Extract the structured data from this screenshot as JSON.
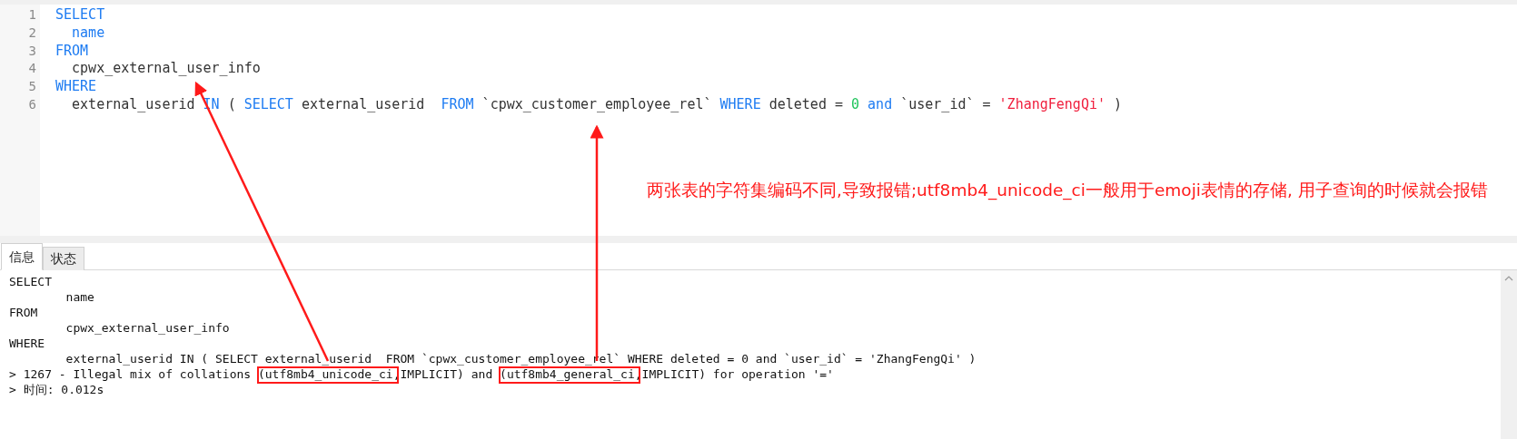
{
  "editor": {
    "lines": [
      {
        "number": "1",
        "tokens": [
          {
            "text": "SELECT",
            "kind": "keyword"
          }
        ]
      },
      {
        "number": "2",
        "tokens": [
          {
            "text": "  name",
            "kind": "keyword"
          }
        ]
      },
      {
        "number": "3",
        "tokens": [
          {
            "text": "FROM",
            "kind": "keyword"
          }
        ]
      },
      {
        "number": "4",
        "tokens": [
          {
            "text": "  cpwx_external_user_info",
            "kind": "plain"
          }
        ]
      },
      {
        "number": "5",
        "tokens": [
          {
            "text": "WHERE",
            "kind": "keyword"
          }
        ]
      },
      {
        "number": "6",
        "tokens": [
          {
            "text": "  external_userid ",
            "kind": "plain"
          },
          {
            "text": "IN",
            "kind": "keyword"
          },
          {
            "text": " ( ",
            "kind": "plain"
          },
          {
            "text": "SELECT",
            "kind": "keyword"
          },
          {
            "text": " external_userid  ",
            "kind": "plain"
          },
          {
            "text": "FROM",
            "kind": "keyword"
          },
          {
            "text": " `cpwx_customer_employee_rel` ",
            "kind": "plain"
          },
          {
            "text": "WHERE",
            "kind": "keyword"
          },
          {
            "text": " deleted = ",
            "kind": "plain"
          },
          {
            "text": "0",
            "kind": "number"
          },
          {
            "text": " and",
            "kind": "keyword"
          },
          {
            "text": " `user_id` = ",
            "kind": "plain"
          },
          {
            "text": "'ZhangFengQi'",
            "kind": "string"
          },
          {
            "text": " )",
            "kind": "plain"
          }
        ]
      }
    ],
    "note": "两张表的字符集编码不同,导致报错;utf8mb4_unicode_ci一般用于emoji表情的存储, 用子查询的时候就会报错"
  },
  "tabs": [
    {
      "label": "信息",
      "selected": true
    },
    {
      "label": "状态",
      "selected": false
    }
  ],
  "output": {
    "lines": [
      {
        "tokens": [
          {
            "text": "SELECT",
            "kind": "plain"
          }
        ]
      },
      {
        "tokens": [
          {
            "text": "        name",
            "kind": "plain"
          }
        ]
      },
      {
        "tokens": [
          {
            "text": "FROM",
            "kind": "plain"
          }
        ]
      },
      {
        "tokens": [
          {
            "text": "        cpwx_external_user_info",
            "kind": "plain"
          }
        ]
      },
      {
        "tokens": [
          {
            "text": "WHERE",
            "kind": "plain"
          }
        ]
      },
      {
        "tokens": [
          {
            "text": "        external_userid IN ( SELECT external_userid  FROM `cpwx_customer_employee_rel` WHERE deleted = 0 and `user_id` = 'ZhangFengQi' )",
            "kind": "plain"
          }
        ]
      },
      {
        "tokens": [
          {
            "text": "> 1267 - Illegal mix of collations (",
            "kind": "plain"
          },
          {
            "text": "utf8mb4_unicode_ci",
            "kind": "boxed"
          },
          {
            "text": ",IMPLICIT) and (",
            "kind": "plain"
          },
          {
            "text": "utf8mb4_general_ci",
            "kind": "boxed"
          },
          {
            "text": ",IMPLICIT) for operation '='",
            "kind": "plain"
          }
        ]
      },
      {
        "tokens": [
          {
            "text": "> 时间: 0.012s",
            "kind": "plain"
          }
        ]
      }
    ]
  }
}
